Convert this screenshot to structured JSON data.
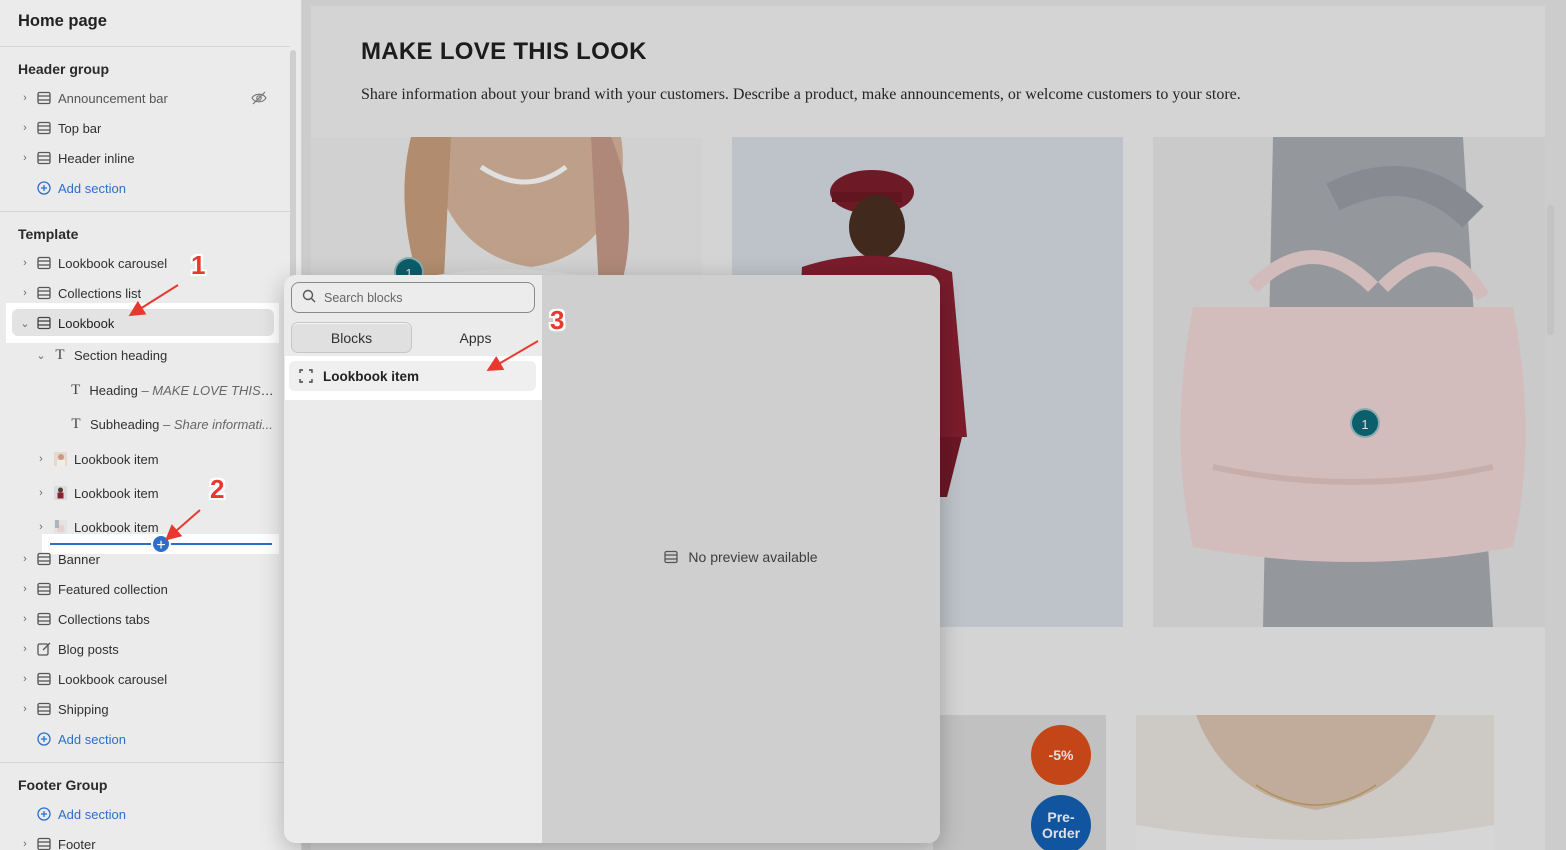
{
  "sidebar": {
    "title": "Home page",
    "header_group": {
      "label": "Header group",
      "items": [
        {
          "label": "Announcement bar",
          "hidden": true
        },
        {
          "label": "Top bar"
        },
        {
          "label": "Header inline"
        }
      ],
      "add_label": "Add section"
    },
    "template": {
      "label": "Template",
      "items": [
        {
          "label": "Lookbook carousel"
        },
        {
          "label": "Collections list"
        },
        {
          "label": "Lookbook",
          "expanded": true,
          "selected": true
        }
      ],
      "lookbook_children": {
        "section_heading": "Section heading",
        "heading": {
          "name": "Heading",
          "value": " – MAKE LOVE THIS L..."
        },
        "subheading": {
          "name": "Subheading",
          "value": " – Share informati..."
        },
        "items": [
          "Lookbook item",
          "Lookbook item",
          "Lookbook item"
        ]
      },
      "after_items": [
        {
          "label": "Banner"
        },
        {
          "label": "Featured collection"
        },
        {
          "label": "Collections tabs"
        },
        {
          "label": "Blog posts"
        },
        {
          "label": "Lookbook carousel"
        },
        {
          "label": "Shipping"
        }
      ],
      "add_label": "Add section"
    },
    "footer_group": {
      "label": "Footer Group",
      "add_label": "Add section",
      "items": [
        {
          "label": "Footer"
        }
      ]
    }
  },
  "preview": {
    "heading": "MAKE LOVE THIS LOOK",
    "subheading": "Share information about your brand with your customers. Describe a product, make announcements, or welcome customers to your store.",
    "hotspot_label": "1",
    "badges": {
      "discount": "-5%",
      "preorder_line1": "Pre-",
      "preorder_line2": "Order"
    }
  },
  "popover": {
    "search_placeholder": "Search blocks",
    "tabs": [
      {
        "label": "Blocks",
        "active": true
      },
      {
        "label": "Apps",
        "active": false
      }
    ],
    "block_item": "Lookbook item",
    "no_preview": "No preview available"
  },
  "annotations": [
    "1",
    "2",
    "3"
  ],
  "colors": {
    "accent_blue": "#2c6ecb",
    "hotspot_teal": "#0d6b7a",
    "annotation_red": "#e8392f",
    "badge_orange": "#e0501c",
    "badge_blue": "#1461b8"
  }
}
